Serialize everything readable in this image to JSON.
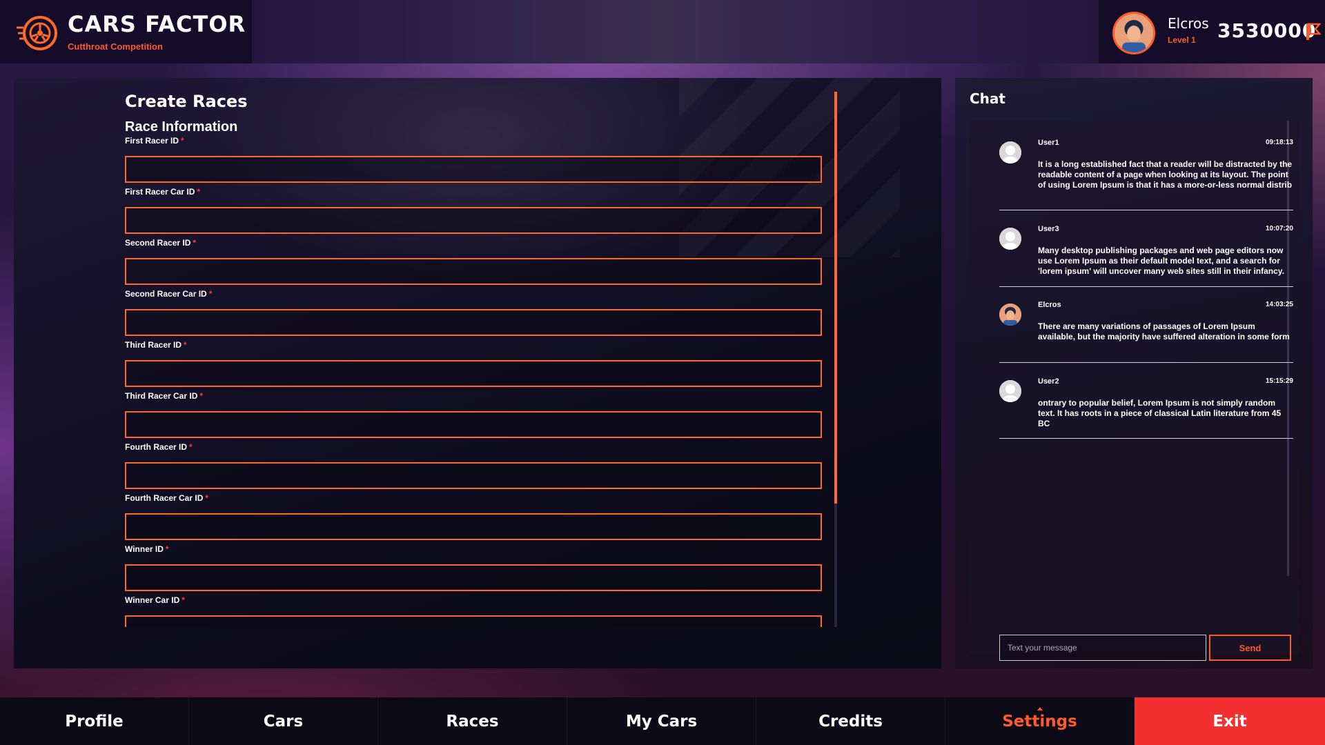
{
  "brand": {
    "title": "CARS FACTOR",
    "subtitle": "Cutthroat Competition",
    "logo_icon": "wheel-logo-icon"
  },
  "user": {
    "name": "Elcros",
    "level": "Level 1",
    "credits": "3530000",
    "credits_icon": "credits-flag-icon"
  },
  "main": {
    "page_title": "Create Races",
    "section_title": "Race Information",
    "required_marker": "*",
    "fields": [
      {
        "label": "First Racer ID",
        "value": ""
      },
      {
        "label": "First Racer Car ID",
        "value": ""
      },
      {
        "label": "Second Racer ID",
        "value": ""
      },
      {
        "label": "Second Racer Car ID",
        "value": ""
      },
      {
        "label": "Third Racer ID",
        "value": ""
      },
      {
        "label": "Third Racer Car ID",
        "value": ""
      },
      {
        "label": "Fourth Racer ID",
        "value": ""
      },
      {
        "label": "Fourth Racer Car ID",
        "value": ""
      },
      {
        "label": "Winner ID",
        "value": ""
      },
      {
        "label": "Winner Car ID",
        "value": ""
      }
    ]
  },
  "chat": {
    "title": "Chat",
    "messages": [
      {
        "user": "User1",
        "time": "09:18:13",
        "avatar": "default-avatar-icon",
        "text": "It is a long established fact that a reader will be distracted by the readable content of a page when looking at its layout. The point of using Lorem Ipsum is that it has a more-or-less normal distrib"
      },
      {
        "user": "User3",
        "time": "10:07:20",
        "avatar": "default-avatar-icon",
        "text": "Many desktop publishing packages and web page editors now use Lorem Ipsum as their default model text, and a search for 'lorem ipsum' will uncover many web sites still in their infancy."
      },
      {
        "user": "Elcros",
        "time": "14:03:25",
        "avatar": "user-photo-avatar",
        "text": "There are many variations of passages of Lorem Ipsum available, but the majority have suffered alteration in some form"
      },
      {
        "user": "User2",
        "time": "15:15:29",
        "avatar": "default-avatar-icon",
        "text": "ontrary to popular belief, Lorem Ipsum is not simply random text. It has roots in a piece of classical Latin literature from 45 BC"
      }
    ],
    "input_placeholder": "Text your message",
    "send_label": "Send"
  },
  "nav": {
    "items": [
      {
        "label": "Profile"
      },
      {
        "label": "Cars"
      },
      {
        "label": "Races"
      },
      {
        "label": "My Cars"
      },
      {
        "label": "Credits"
      },
      {
        "label": "Settings"
      },
      {
        "label": "Exit"
      }
    ],
    "active": "Settings"
  },
  "colors": {
    "accent": "#ff5a2c",
    "exit": "#f2302f",
    "required": "#ff3b3b"
  }
}
